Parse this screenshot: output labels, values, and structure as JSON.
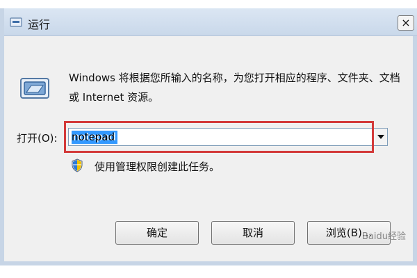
{
  "window": {
    "title": "运行"
  },
  "dialog": {
    "description": "Windows 将根据您所输入的名称，为您打开相应的程序、文件夹、文档或 Internet 资源。",
    "open_label": "打开(O):",
    "input_value": "notepad",
    "admin_text": "使用管理权限创建此任务。"
  },
  "buttons": {
    "ok": "确定",
    "cancel": "取消",
    "browse": "浏览(B)..."
  },
  "watermark": "Baidu经验",
  "icons": {
    "title_icon": "run-window-icon",
    "program_icon": "run-program-icon",
    "shield_icon": "uac-shield-icon",
    "close_icon": "close-icon",
    "dropdown_icon": "chevron-down-icon"
  },
  "colors": {
    "selection": "#3399ff",
    "highlight": "#d33a3a",
    "titlebar": "#dbe6f3"
  }
}
